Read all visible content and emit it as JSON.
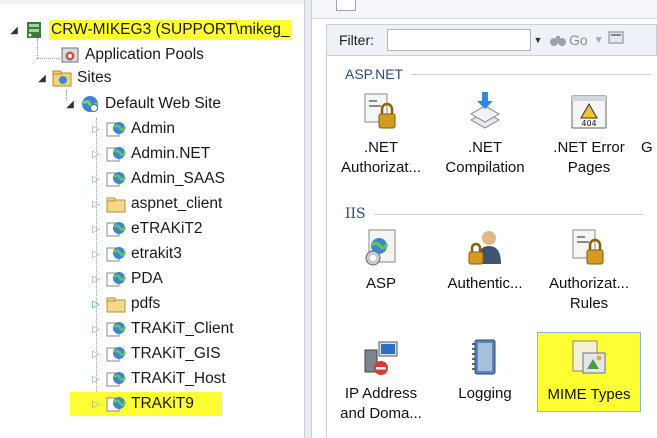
{
  "tree": {
    "server": "CRW-MIKEG3 (SUPPORT\\mikeg_",
    "app_pools": "Application Pools",
    "sites": "Sites",
    "default_site": "Default Web Site",
    "children": [
      "Admin",
      "Admin.NET",
      "Admin_SAAS",
      "aspnet_client",
      "eTRAKiT2",
      "etrakit3",
      "PDA",
      "pdfs",
      "TRAKiT_Client",
      "TRAKiT_GIS",
      "TRAKiT_Host",
      "TRAKiT9"
    ],
    "highlight_color": "#ffff33"
  },
  "filter": {
    "label": "Filter:",
    "value": "",
    "go_label": "Go"
  },
  "groups": {
    "aspnet": "ASP.NET",
    "iis": "IIS"
  },
  "features": {
    "net_auth": {
      "line1": ".NET",
      "line2": "Authorizat..."
    },
    "net_comp": {
      "line1": ".NET",
      "line2": "Compilation"
    },
    "net_error": {
      "line1": ".NET Error",
      "line2": "Pages"
    },
    "net_partial": {
      "line1": "",
      "line2": "G"
    },
    "asp": {
      "line1": "ASP"
    },
    "authentic": {
      "line1": "Authentic..."
    },
    "authoriz": {
      "line1": "Authorizat...",
      "line2": "Rules"
    },
    "ip": {
      "line1": "IP Address",
      "line2": "and Doma..."
    },
    "logging": {
      "line1": "Logging"
    },
    "mime": {
      "line1": "MIME Types"
    }
  },
  "icons": {
    "error_page_text": "404"
  }
}
